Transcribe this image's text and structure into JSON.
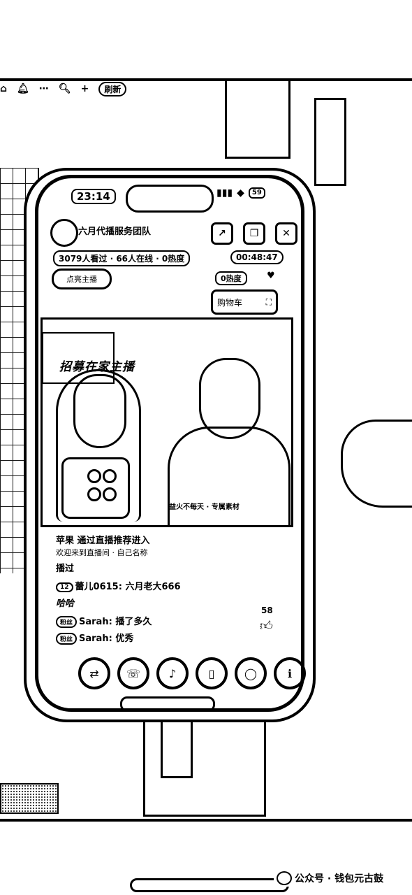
{
  "status_bar": {
    "time": "23:14",
    "battery": "59"
  },
  "live": {
    "host_name": "六月代播服务团队",
    "stats": "3079人看过 · 66人在线 · 0热度",
    "timer": "00:48:47",
    "follow_label": "点亮主播",
    "heat_label": "0热度",
    "cart_label": "购物车"
  },
  "video": {
    "title_overlay": "招募在家主播",
    "caption": "益火不每天 · 专属素材"
  },
  "comments": [
    {
      "text": "苹果 通过直播推荐进入"
    },
    {
      "text": "欢迎来到直播间 · 自己名称"
    },
    {
      "text": "播过"
    },
    {
      "badge": "12",
      "user": "蕾儿0615",
      "text": "六月老大666"
    },
    {
      "text": "哈哈"
    },
    {
      "badge": "粉丝",
      "user": "Sarah",
      "text": "播了多久"
    },
    {
      "badge": "粉丝",
      "user": "Sarah",
      "text": "优秀"
    }
  ],
  "likes": "58",
  "bottom_actions": [
    {
      "icon": "share-icon"
    },
    {
      "icon": "phone-icon"
    },
    {
      "icon": "music-icon"
    },
    {
      "icon": "clipboard-icon"
    },
    {
      "icon": "camera-icon"
    },
    {
      "icon": "info-icon"
    }
  ],
  "background_bar": {
    "label": "刷新"
  },
  "footer": {
    "text": "公众号 · 钱包元古鼓"
  }
}
